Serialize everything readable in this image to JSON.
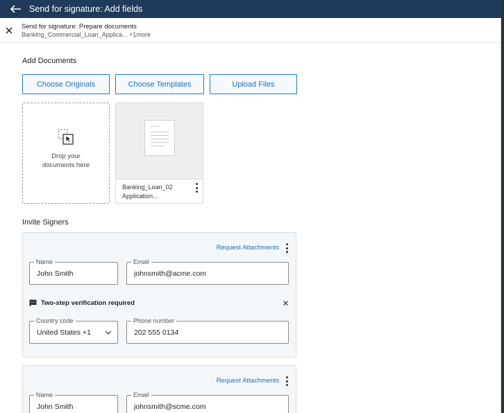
{
  "topbar": {
    "title": "Send for signature: Add fields"
  },
  "subheader": {
    "line1": "Send for signature: Prepare documents",
    "line2": "Banking_Commercial_Loan_Applica... +1more"
  },
  "add_documents": {
    "heading": "Add Documents",
    "buttons": [
      "Choose Originals",
      "Choose Templates",
      "Upload Files"
    ],
    "dropzone_line1": "Drop your",
    "dropzone_line2": "documents here",
    "document": {
      "name_line1": "Banking_Loan_02",
      "name_line2": "Application..."
    }
  },
  "invite_signers": {
    "heading": "Invite Signers",
    "signers": [
      {
        "request_attachments": "Request Attachments",
        "name_label": "Name",
        "name_value": "John Smith",
        "email_label": "Email",
        "email_value": "johnsmith@acme.com",
        "two_step": "Two-step verification required",
        "country_label": "Country code",
        "country_value": "United States +1",
        "phone_label": "Phone number",
        "phone_value": "202 555 0134"
      },
      {
        "request_attachments": "Request Attachments",
        "name_label": "Name",
        "name_value": "John Smith",
        "email_label": "Email",
        "email_value": "johnsmith@scme.com"
      }
    ]
  },
  "colors": {
    "topbar": "#1f3a5a",
    "accent": "#1a6fc4",
    "signer_bg": "#f4f7fa"
  }
}
